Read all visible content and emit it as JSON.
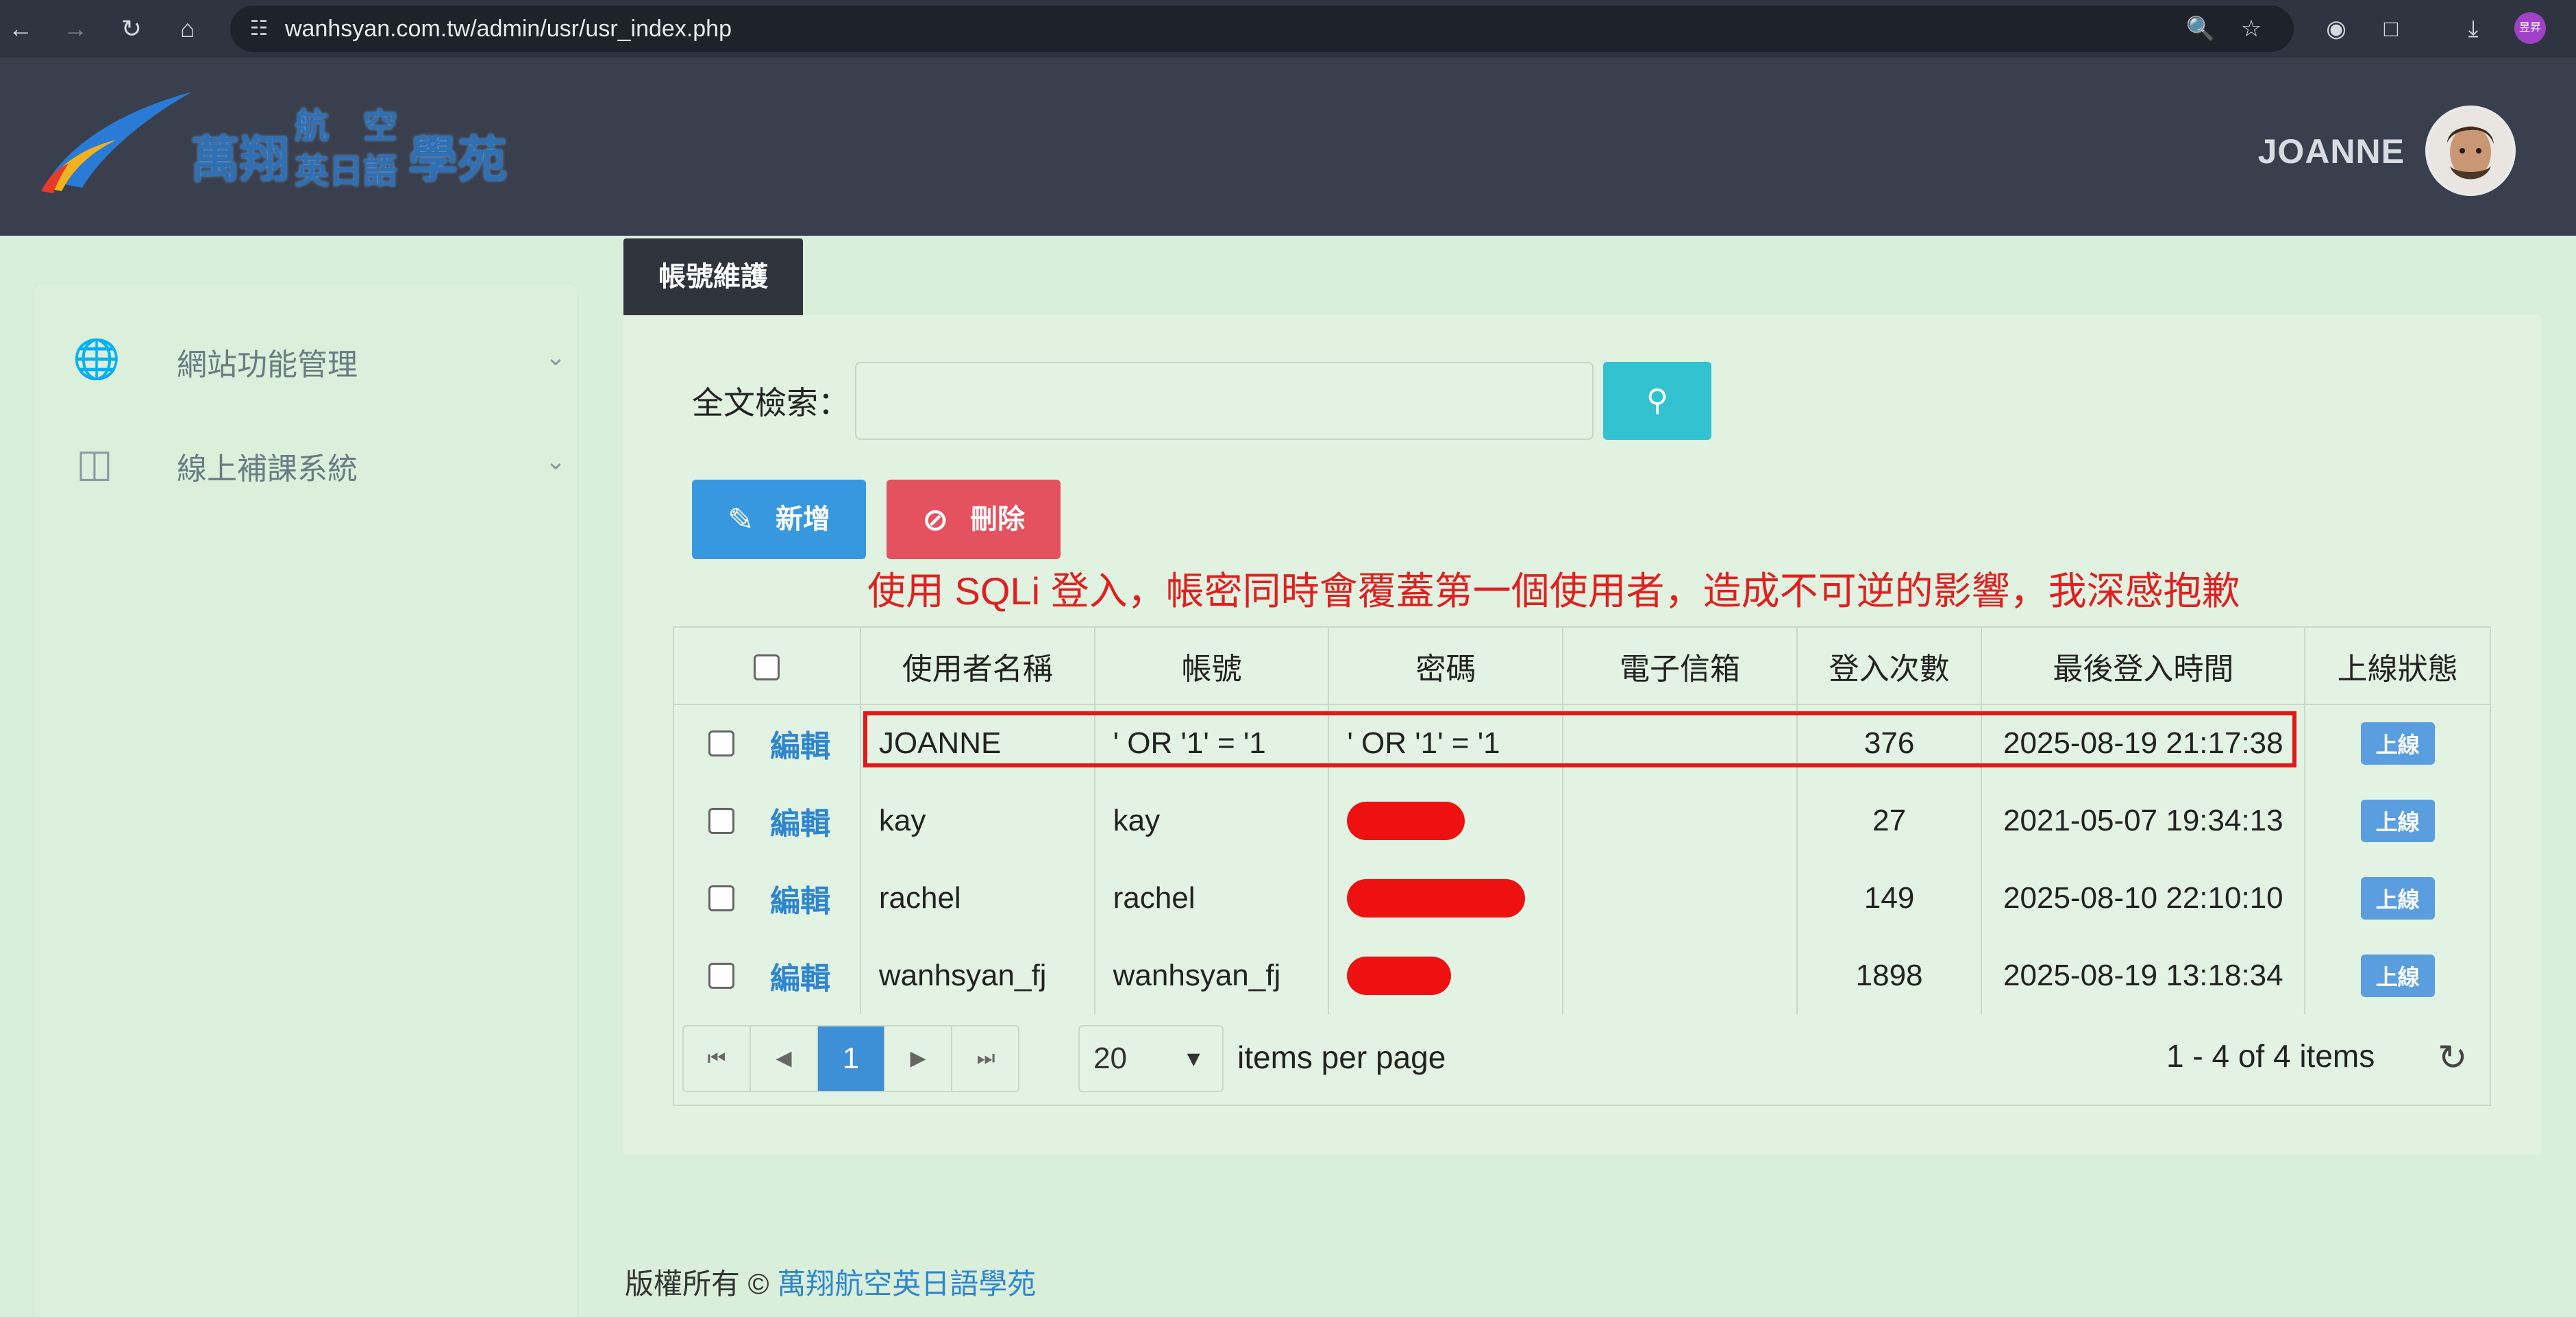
{
  "browser": {
    "url_host": "wanhsyan.com.tw",
    "url_path": "/admin/usr/usr_index.php",
    "profile_initials": "昱昇"
  },
  "header": {
    "logo_text_1": "萬翔",
    "logo_text_2a": "航",
    "logo_text_2b": "空",
    "logo_text_3": "英日語",
    "logo_text_4": "學苑",
    "user_name": "JOANNE"
  },
  "sidebar": {
    "items": [
      {
        "label": "網站功能管理",
        "icon": "globe-icon"
      },
      {
        "label": "線上補課系統",
        "icon": "video-icon"
      }
    ]
  },
  "page": {
    "tab_title": "帳號維護",
    "search_label": "全文檢索：",
    "search_value": "",
    "add_label": "新增",
    "delete_label": "刪除",
    "annotation": "使用 SQLi 登入，帳密同時會覆蓋第一個使用者，造成不可逆的影響，我深感抱歉"
  },
  "table": {
    "columns": [
      "使用者名稱",
      "帳號",
      "密碼",
      "電子信箱",
      "登入次數",
      "最後登入時間",
      "上線狀態"
    ],
    "edit_label": "編輯",
    "rows": [
      {
        "name": "JOANNE",
        "account": "' OR '1' = '1",
        "password": "' OR '1' = '1",
        "email": "",
        "logins": "376",
        "last_login": "2025-08-19 21:17:38",
        "status": "上線",
        "redacted": false
      },
      {
        "name": "kay",
        "account": "kay",
        "password": "",
        "email": "",
        "logins": "27",
        "last_login": "2021-05-07 19:34:13",
        "status": "上線",
        "redacted": true
      },
      {
        "name": "rachel",
        "account": "rachel",
        "password": "",
        "email": "",
        "logins": "149",
        "last_login": "2025-08-10 22:10:10",
        "status": "上線",
        "redacted": true
      },
      {
        "name": "wanhsyan_fj",
        "account": "wanhsyan_fj",
        "password": "",
        "email": "",
        "logins": "1898",
        "last_login": "2025-08-19 13:18:34",
        "status": "上線",
        "redacted": true
      }
    ]
  },
  "pager": {
    "current_page": "1",
    "page_size": "20",
    "per_page_label": "items per page",
    "count_text": "1 - 4 of 4 items"
  },
  "footer": {
    "copyright": "版權所有 © ",
    "org": "萬翔航空英日語學苑"
  },
  "colors": {
    "accent_blue": "#3898df",
    "danger_red": "#e3525e",
    "search_teal": "#33c2cf",
    "annotation_red": "#e02020"
  }
}
